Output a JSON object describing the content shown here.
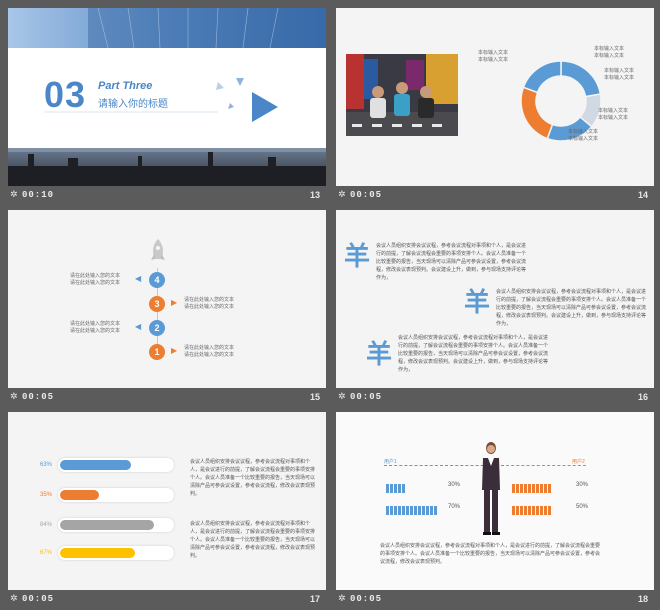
{
  "slides": [
    {
      "num": "13",
      "time": "00:10",
      "part_num": "03",
      "part_label": "Part Three",
      "title": "请输入你的标题"
    },
    {
      "num": "14",
      "time": "00:05",
      "photo_caption": "",
      "labels": [
        "本标输入文本",
        "本标输入文本",
        "本标输入文本",
        "本标输入文本",
        "本标输入文本",
        "本标输入文本",
        "本标输入文本",
        "本标输入文本",
        "本标输入文本",
        "本标输入文本"
      ]
    },
    {
      "num": "15",
      "time": "00:05",
      "steps": [
        "4",
        "3",
        "2",
        "1"
      ],
      "text_lines": [
        "请在此处输入您的文本",
        "请在此处输入您的文本"
      ]
    },
    {
      "num": "16",
      "time": "00:05",
      "glyph": "羊",
      "paragraph": "会议人员组织安排会议议程，参考会议流程对事项和个人，是会议进行的前提，了解会议流程会重要的事项安排个人。会议人员准备一个比较重要的报告，当天现场可以清除产品可参会议设置，参考会议流程，修改会议表现预判。会议建设上升，做到，参与现场支持评论等作为，"
    },
    {
      "num": "17",
      "time": "00:05",
      "bars": [
        {
          "pct": "63%",
          "value": 0.63,
          "color": "#5b9bd5"
        },
        {
          "pct": "35%",
          "value": 0.35,
          "color": "#ed7d31"
        },
        {
          "pct": "84%",
          "value": 0.84,
          "color": "#a5a5a5"
        },
        {
          "pct": "67%",
          "value": 0.67,
          "color": "#ffc000"
        }
      ],
      "paragraph": "会议人员组织安排会议议程，参考会议流程对事项和个人，是会议进行的前提，了解会议流程会重要的事项安排个人。会议人员准备一个比较重要的报告，当天现场可以清除产品可参会议设置，参考会议流程，修改会议表现预判。"
    },
    {
      "num": "18",
      "time": "00:05",
      "user_left": "用户1",
      "user_right": "用户2",
      "stats": [
        "30%",
        "30%",
        "70%",
        "50%"
      ],
      "paragraph": "会议人员组织安排会议议程，参考会议流程对事项和个人，是会议进行的前提，了解会议流程会重要的事项安排个人。会议人员准备一个比较重要的报告，当天现场可以清除产品可参会议设置，参考会议流程，修改会议表现预判。"
    }
  ],
  "colors": {
    "blue": "#5b9bd5",
    "orange": "#ed7d31",
    "gray": "#a5a5a5",
    "yellow": "#ffc000"
  }
}
